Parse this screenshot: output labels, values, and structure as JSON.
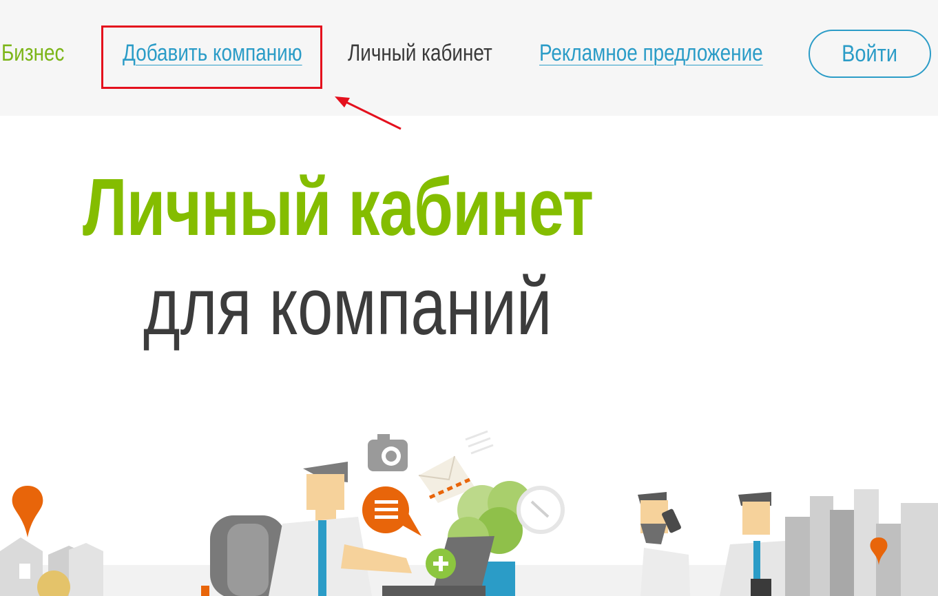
{
  "nav": {
    "business": "Бизнес",
    "add_company": "Добавить компанию",
    "personal_cabinet": "Личный кабинет",
    "ad_offer": "Рекламное предложение",
    "login": "Войти"
  },
  "hero": {
    "title": "Личный кабинет",
    "subtitle": "для компаний"
  },
  "colors": {
    "accent_green": "#84bd00",
    "link_blue": "#2b9cc7",
    "highlight_red": "#e4101d",
    "illustration_orange": "#e8650a"
  },
  "icons": [
    "camera-icon",
    "envelope-icon",
    "chat-icon",
    "plus-icon",
    "clock-icon",
    "phone-icon",
    "map-pin-icon"
  ]
}
